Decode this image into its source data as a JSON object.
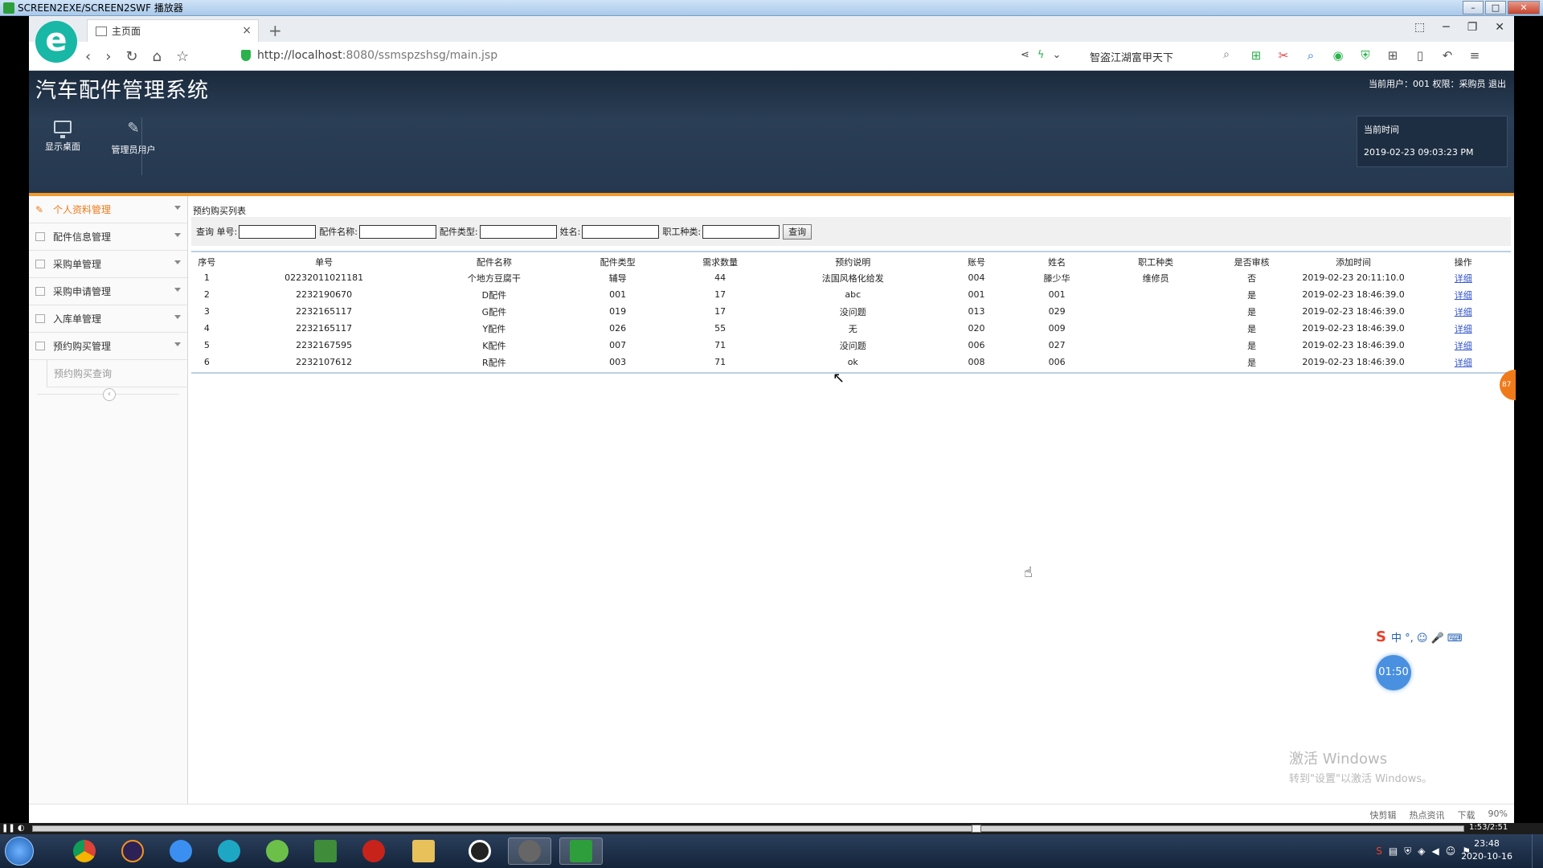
{
  "player": {
    "title": "SCREEN2EXE/SCREEN2SWF 播放器",
    "time": "1:53/2:51",
    "progress_fraction": 0.66
  },
  "browser": {
    "tab_label": "主页面",
    "url_host": "http://localhost",
    "url_rest": ":8080/ssmspzshsg/main.jsp",
    "search_text": "智盗江湖富甲天下",
    "zoom": "90%",
    "status_items": [
      "快剪辑",
      "热点资讯",
      "下载"
    ]
  },
  "app": {
    "title": "汽车配件管理系统",
    "user_info": "当前用户：001 权限：采购员 退出",
    "toolbar": {
      "desktop_label": "显示桌面",
      "admin_label": "管理员用户"
    },
    "time_label": "当前时间",
    "time_value": "2019-02-23 09:03:23 PM"
  },
  "sidebar": {
    "items": [
      {
        "label": "个人资料管理",
        "active": true
      },
      {
        "label": "配件信息管理",
        "active": false
      },
      {
        "label": "采购单管理",
        "active": false
      },
      {
        "label": "采购申请管理",
        "active": false
      },
      {
        "label": "入库单管理",
        "active": false
      },
      {
        "label": "预约购买管理",
        "active": false
      }
    ],
    "sub_item": "预约购买查询"
  },
  "main": {
    "caption": "预约购买列表",
    "query": {
      "prefix": "查询 单号:",
      "name_label": "配件名称:",
      "type_label": "配件类型:",
      "person_label": "姓名:",
      "job_label": "职工种类:",
      "button": "查询"
    },
    "columns": [
      "序号",
      "单号",
      "配件名称",
      "配件类型",
      "需求数量",
      "预约说明",
      "账号",
      "姓名",
      "职工种类",
      "是否审核",
      "添加时间",
      "操作"
    ],
    "rows": [
      [
        "1",
        "02232011021181",
        "个地方豆腐干",
        "辅导",
        "44",
        "法国风格化给发",
        "004",
        "滕少华",
        "维修员",
        "否",
        "2019-02-23 20:11:10.0",
        "详细"
      ],
      [
        "2",
        "2232190670",
        "D配件",
        "001",
        "17",
        "abc",
        "001",
        "001",
        "",
        "是",
        "2019-02-23 18:46:39.0",
        "详细"
      ],
      [
        "3",
        "2232165117",
        "G配件",
        "019",
        "17",
        "没问题",
        "013",
        "029",
        "",
        "是",
        "2019-02-23 18:46:39.0",
        "详细"
      ],
      [
        "4",
        "2232165117",
        "Y配件",
        "026",
        "55",
        "无",
        "020",
        "009",
        "",
        "是",
        "2019-02-23 18:46:39.0",
        "详细"
      ],
      [
        "5",
        "2232167595",
        "K配件",
        "007",
        "71",
        "没问题",
        "006",
        "027",
        "",
        "是",
        "2019-02-23 18:46:39.0",
        "详细"
      ],
      [
        "6",
        "2232107612",
        "R配件",
        "003",
        "71",
        "ok",
        "008",
        "006",
        "",
        "是",
        "2019-02-23 18:46:39.0",
        "详细"
      ]
    ]
  },
  "overlay": {
    "side_badge": "87",
    "timer": "01:50",
    "ime_text": "中 °, ☺ 🎤 ⌨",
    "watermark_title": "激活 Windows",
    "watermark_sub": "转到\"设置\"以激活 Windows。"
  },
  "taskbar": {
    "clock_time": "23:48",
    "clock_date": "2020-10-16"
  }
}
